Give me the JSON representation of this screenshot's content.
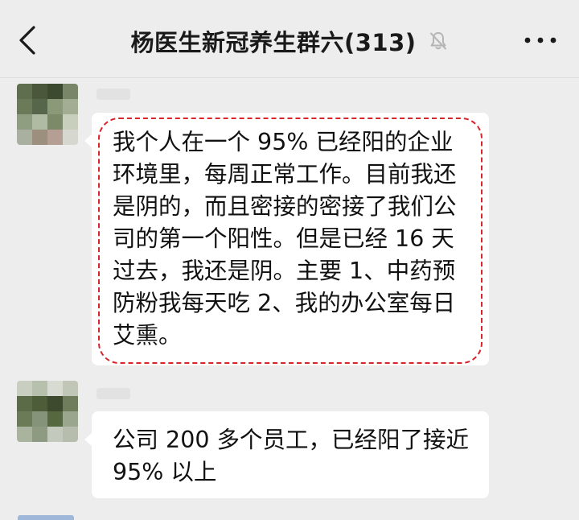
{
  "header": {
    "title": "杨医生新冠养生群六(313)",
    "back_icon": "chevron-left-icon",
    "mute_icon": "bell-muted-icon",
    "more_icon": "more-dots-icon"
  },
  "messages": [
    {
      "text": "我个人在一个 95% 已经阳的企业\n环境里，每周正常工作。目前我还\n是阴的，而且密接的密接了我们公\n司的第一个阳性。但是已经 16 天\n过去，我还是阴。主要 1、中药预\n防粉我每天吃 2、我的办公室每日\n艾熏。",
      "avatar_colors": [
        "#5f6e4e",
        "#4a573a",
        "#3c4a2f",
        "#7a8668",
        "#6b7a58",
        "#55664a",
        "#8a9977",
        "#a3ad93",
        "#8f9d80",
        "#b0bba3",
        "#7c8a6a",
        "#c8cfbd",
        "#aab09f",
        "#9c8f7e",
        "#b59e93",
        "#d6d8cf"
      ]
    },
    {
      "text": "公司 200 多个员工，已经阳了接近\n95% 以上",
      "avatar_colors": [
        "#c8cec0",
        "#b7c0ac",
        "#d7dbd2",
        "#c0c7b7",
        "#5b6b47",
        "#4d5d3a",
        "#3e4a2e",
        "#6f7d5c",
        "#6c7b57",
        "#85937a",
        "#56683f",
        "#9aa68d",
        "#a9b39e",
        "#8f9a83",
        "#c3c9bc",
        "#b6bdad"
      ]
    }
  ],
  "colors": {
    "background": "#ededed",
    "bubble": "#ffffff",
    "highlight_border": "#d9242b"
  }
}
